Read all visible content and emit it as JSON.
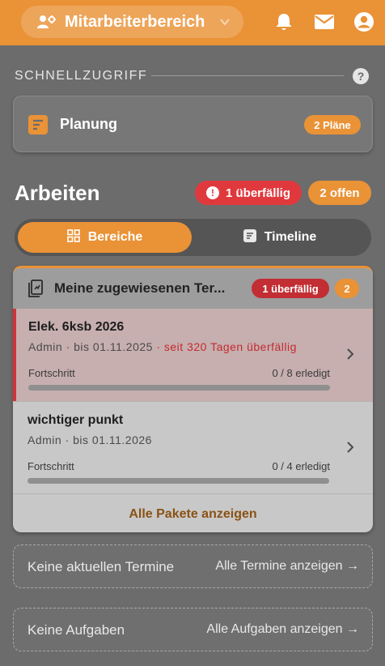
{
  "header": {
    "area_label": "Mitarbeiterbereich",
    "area_icon": "users-gear-icon",
    "icons": [
      "bell-icon",
      "mail-icon",
      "account-icon"
    ],
    "accent": "#ea9236"
  },
  "quick_access": {
    "title": "SCHNELLZUGRIFF",
    "help": "?",
    "planning": {
      "label": "Planung",
      "badge": "2 Pläne"
    }
  },
  "work": {
    "title": "Arbeiten",
    "overdue_badge": "1 überfällig",
    "open_badge": "2 offen",
    "tabs": [
      {
        "label": "Bereiche",
        "active": true
      },
      {
        "label": "Timeline",
        "active": false
      }
    ]
  },
  "assigned": {
    "title": "Meine zugewiesenen Ter...",
    "overdue_badge": "1 überfällig",
    "count_badge": "2",
    "items": [
      {
        "name": "Elek. 6ksb 2026",
        "meta": "Admin · bis 01.11.2025",
        "overdue_text": "· seit 320 Tagen überfällig",
        "progress_label": "Fortschritt",
        "progress_value": "0 / 8 erledigt",
        "progress_fraction": 0
      },
      {
        "name": "wichtiger punkt",
        "meta": "Admin · bis 01.11.2026",
        "overdue_text": "",
        "progress_label": "Fortschritt",
        "progress_value": "0 / 4 erledigt",
        "progress_fraction": 0
      }
    ],
    "all_link": "Alle Pakete anzeigen"
  },
  "appointments": {
    "empty": "Keine aktuellen Termine",
    "link": "Alle Termine anzeigen →"
  },
  "tasks": {
    "empty": "Keine Aufgaben",
    "link": "Alle Aufgaben anzeigen →"
  }
}
